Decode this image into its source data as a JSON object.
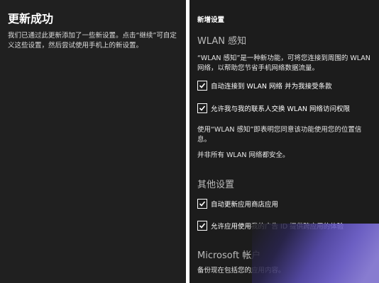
{
  "left": {
    "title": "更新成功",
    "body": "我们已通过此更新添加了一些新设置。点击“继续”可自定义这些设置，然后尝试使用手机上的新设置。"
  },
  "right": {
    "header": "新增设置",
    "wlan_section": {
      "title": "WLAN 感知",
      "description": "“WLAN 感知”是一种新功能，可将您连接到周围的 WLAN 网络，以帮助您节省手机网络数据流量。",
      "options": [
        {
          "label": "自动连接到 WLAN 网络   并为我接受条款",
          "checked": true
        },
        {
          "label": "允许我与我的联系人交换 WLAN 网络访问权限",
          "checked": true
        }
      ],
      "note1": "使用“WLAN 感知”即表明您同意该功能使用您的位置信息。",
      "note2": "并非所有 WLAN 网络都安全。"
    },
    "other_section": {
      "title": "其他设置",
      "options": [
        {
          "label": "自动更新应用商店应用",
          "checked": true
        },
        {
          "label": "允许应用使用我的广告 ID 提供跨应用的体验",
          "checked": true
        }
      ]
    },
    "ms_section": {
      "title": "Microsoft 帐户",
      "description": "备份现在包括您的应用内容。"
    }
  }
}
